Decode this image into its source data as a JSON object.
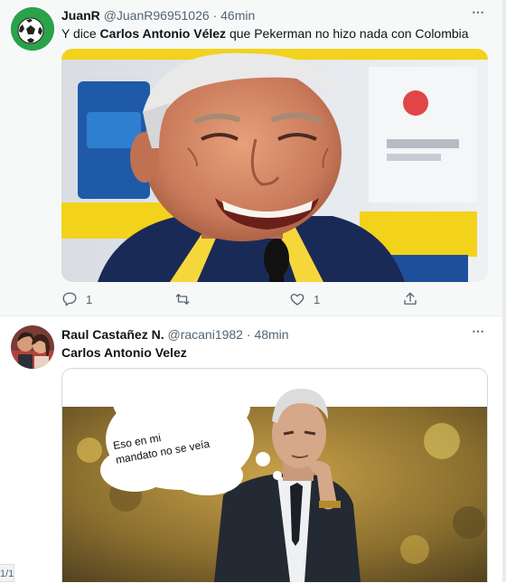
{
  "tweets": [
    {
      "display_name": "JuanR",
      "handle": "@JuanR96951026",
      "separator": "·",
      "time": "46min",
      "more": "⋯",
      "text_parts": [
        "Y dice ",
        "Carlos Antonio Vélez",
        " que Pekerman no hizo nada con Colombia"
      ],
      "actions": {
        "reply_count": "1",
        "retweet_count": "",
        "like_count": "1"
      },
      "media": {
        "type": "photo"
      }
    },
    {
      "display_name": "Raul Castañez N.",
      "handle": "@racani1982",
      "separator": "·",
      "time": "48min",
      "more": "⋯",
      "text": "Carlos Antonio Velez",
      "media": {
        "type": "photo",
        "bubble_text": [
          "Eso en mi",
          "mandato no se veía"
        ]
      }
    }
  ],
  "pagination": "1/1",
  "icons": {
    "reply": "reply-icon",
    "retweet": "retweet-icon",
    "like": "heart-icon",
    "share": "share-icon",
    "more": "more-options-icon"
  },
  "colors": {
    "secondary_text": "#536471",
    "primary_text": "#0f1419",
    "tweet1_bg": "#f7f9f9"
  }
}
